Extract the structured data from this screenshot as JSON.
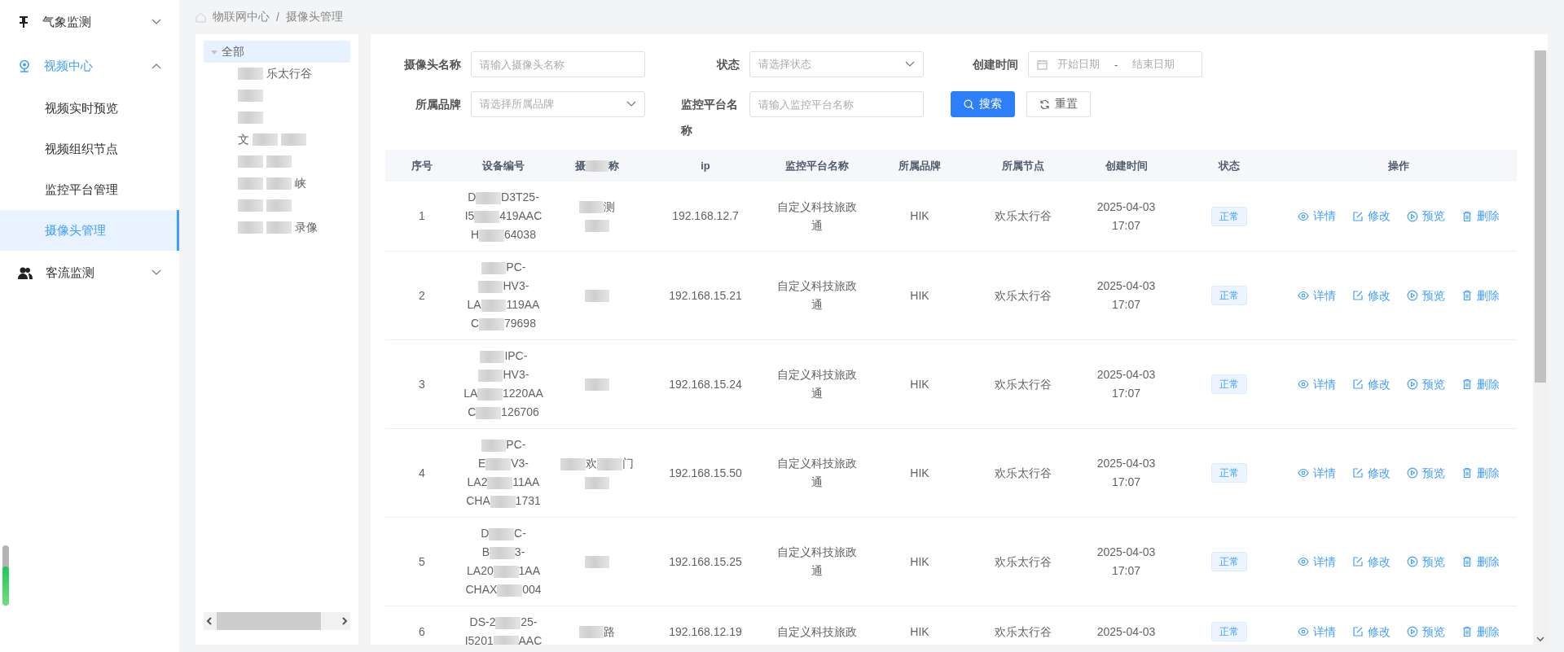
{
  "sidebar": {
    "groups": [
      {
        "label": "气象监测",
        "expanded": false
      },
      {
        "label": "视频中心",
        "expanded": true,
        "items": [
          {
            "label": "视频实时预览",
            "selected": false
          },
          {
            "label": "视频组织节点",
            "selected": false
          },
          {
            "label": "监控平台管理",
            "selected": false
          },
          {
            "label": "摄像头管理",
            "selected": true
          }
        ]
      },
      {
        "label": "客流监测",
        "expanded": false
      }
    ],
    "meter": {
      "level": 0.65
    }
  },
  "breadcrumb": [
    "物联网中心",
    "/",
    "摄像头管理"
  ],
  "tree": {
    "nodes": [
      {
        "label": "全部",
        "expanded": true,
        "selected": true,
        "children": [
          {
            "label": [
              {
                "kind": "blur"
              },
              "乐太行谷"
            ],
            "selected": false
          },
          {
            "label": [
              {
                "kind": "blur"
              }
            ],
            "selected": false
          },
          {
            "label": [
              {
                "kind": "blur"
              }
            ],
            "selected": false
          },
          {
            "label": [
              "文",
              {
                "kind": "blur"
              },
              {
                "kind": "blur"
              }
            ],
            "selected": false
          },
          {
            "label": [
              {
                "kind": "blur"
              },
              {
                "kind": "blur"
              }
            ],
            "selected": false
          },
          {
            "label": [
              {
                "kind": "blur"
              },
              {
                "kind": "blur"
              },
              "峡"
            ],
            "selected": false
          },
          {
            "label": [
              {
                "kind": "blur"
              },
              {
                "kind": "blur"
              }
            ],
            "selected": false
          },
          {
            "label": [
              {
                "kind": "blur"
              },
              {
                "kind": "blur"
              },
              "录像"
            ],
            "selected": false
          }
        ]
      }
    ]
  },
  "filters": [
    {
      "kind": "input",
      "label": "摄像头名称",
      "placeholder": "请输入摄像头名称"
    },
    {
      "kind": "select",
      "label": "状态",
      "placeholder": "请选择状态"
    },
    {
      "kind": "daterange",
      "label": "创建时间",
      "start_placeholder": "开始日期",
      "separator": "-",
      "end_placeholder": "结束日期"
    },
    {
      "kind": "select",
      "label": "所属品牌",
      "placeholder": "请选择所属品牌"
    },
    {
      "kind": "input",
      "label": "监控平台名称",
      "placeholder": "请输入监控平台名称"
    }
  ],
  "buttons": [
    {
      "label": "搜索",
      "kind": "primary"
    },
    {
      "label": "重置",
      "kind": "default"
    }
  ],
  "table": {
    "columns": [
      "序号",
      "设备编号",
      [
        "摄",
        {
          "kind": "blur"
        },
        "称"
      ],
      "ip",
      "监控平台名称",
      "所属品牌",
      "所属节点",
      "创建时间",
      "状态",
      "操作"
    ],
    "rows": [
      {
        "index": "1",
        "device_code": [
          [
            "D",
            {
              "kind": "blur"
            },
            "D3T25-"
          ],
          [
            "I5",
            {
              "kind": "blur"
            },
            "419AAC"
          ],
          [
            "H",
            {
              "kind": "blur"
            },
            "64038"
          ]
        ],
        "camera_name": [
          [
            {
              "kind": "blur"
            },
            "测"
          ],
          [
            {
              "kind": "blur"
            }
          ]
        ],
        "ip": "192.168.12.7",
        "platform": "自定义科技旅政通",
        "brand": "HIK",
        "node": "欢乐太行谷",
        "created": [
          "2025-04-03",
          "17:07"
        ],
        "status": {
          "label": "正常",
          "kind": "normal"
        },
        "actions": [
          "详情",
          "修改",
          "预览",
          "删除"
        ]
      },
      {
        "index": "2",
        "device_code": [
          [
            {
              "kind": "blur"
            },
            "PC-"
          ],
          [
            {
              "kind": "blur"
            },
            "HV3-"
          ],
          [
            "LA",
            {
              "kind": "blur"
            },
            "119AA"
          ],
          [
            "C",
            {
              "kind": "blur"
            },
            "79698"
          ]
        ],
        "camera_name": [
          [
            {
              "kind": "blur"
            }
          ]
        ],
        "ip": "192.168.15.21",
        "platform": "自定义科技旅政通",
        "brand": "HIK",
        "node": "欢乐太行谷",
        "created": [
          "2025-04-03",
          "17:07"
        ],
        "status": {
          "label": "正常",
          "kind": "normal"
        },
        "actions": [
          "详情",
          "修改",
          "预览",
          "删除"
        ]
      },
      {
        "index": "3",
        "device_code": [
          [
            {
              "kind": "blur"
            },
            "IPC-"
          ],
          [
            {
              "kind": "blur"
            },
            "HV3-"
          ],
          [
            "LA",
            {
              "kind": "blur"
            },
            "1220AA"
          ],
          [
            "C",
            {
              "kind": "blur"
            },
            "126706"
          ]
        ],
        "camera_name": [
          [
            {
              "kind": "blur"
            }
          ]
        ],
        "ip": "192.168.15.24",
        "platform": "自定义科技旅政通",
        "brand": "HIK",
        "node": "欢乐太行谷",
        "created": [
          "2025-04-03",
          "17:07"
        ],
        "status": {
          "label": "正常",
          "kind": "normal"
        },
        "actions": [
          "详情",
          "修改",
          "预览",
          "删除"
        ]
      },
      {
        "index": "4",
        "device_code": [
          [
            {
              "kind": "blur"
            },
            "PC-"
          ],
          [
            "E",
            {
              "kind": "blur"
            },
            "V3-"
          ],
          [
            "LA2",
            {
              "kind": "blur"
            },
            "11AA"
          ],
          [
            "CHA",
            {
              "kind": "blur"
            },
            "1731"
          ]
        ],
        "camera_name": [
          [
            {
              "kind": "blur"
            },
            "欢",
            {
              "kind": "blur"
            },
            "门"
          ],
          [
            {
              "kind": "blur"
            }
          ]
        ],
        "ip": "192.168.15.50",
        "platform": "自定义科技旅政通",
        "brand": "HIK",
        "node": "欢乐太行谷",
        "created": [
          "2025-04-03",
          "17:07"
        ],
        "status": {
          "label": "正常",
          "kind": "normal"
        },
        "actions": [
          "详情",
          "修改",
          "预览",
          "删除"
        ]
      },
      {
        "index": "5",
        "device_code": [
          [
            "D",
            {
              "kind": "blur"
            },
            "C-"
          ],
          [
            "B",
            {
              "kind": "blur"
            },
            "3-"
          ],
          [
            "LA20",
            {
              "kind": "blur"
            },
            "1AA"
          ],
          [
            "CHAX",
            {
              "kind": "blur"
            },
            "004"
          ]
        ],
        "camera_name": [
          [
            {
              "kind": "blur"
            }
          ]
        ],
        "ip": "192.168.15.25",
        "platform": "自定义科技旅政通",
        "brand": "HIK",
        "node": "欢乐太行谷",
        "created": [
          "2025-04-03",
          "17:07"
        ],
        "status": {
          "label": "正常",
          "kind": "normal"
        },
        "actions": [
          "详情",
          "修改",
          "预览",
          "删除"
        ]
      },
      {
        "index": "6",
        "device_code": [
          [
            "DS-2",
            {
              "kind": "blur"
            },
            "25-"
          ],
          [
            "I5201",
            {
              "kind": "blur"
            },
            "AAC"
          ]
        ],
        "camera_name": [
          [
            {
              "kind": "blur"
            },
            "路"
          ]
        ],
        "ip": "192.168.12.19",
        "platform": "自定义科技旅政",
        "brand": "HIK",
        "node": "欢乐太行谷",
        "created": [
          "2025-04-03"
        ],
        "status": {
          "label": "正常",
          "kind": "normal"
        },
        "actions": [
          "详情",
          "修改",
          "预览",
          "删除"
        ]
      }
    ]
  }
}
